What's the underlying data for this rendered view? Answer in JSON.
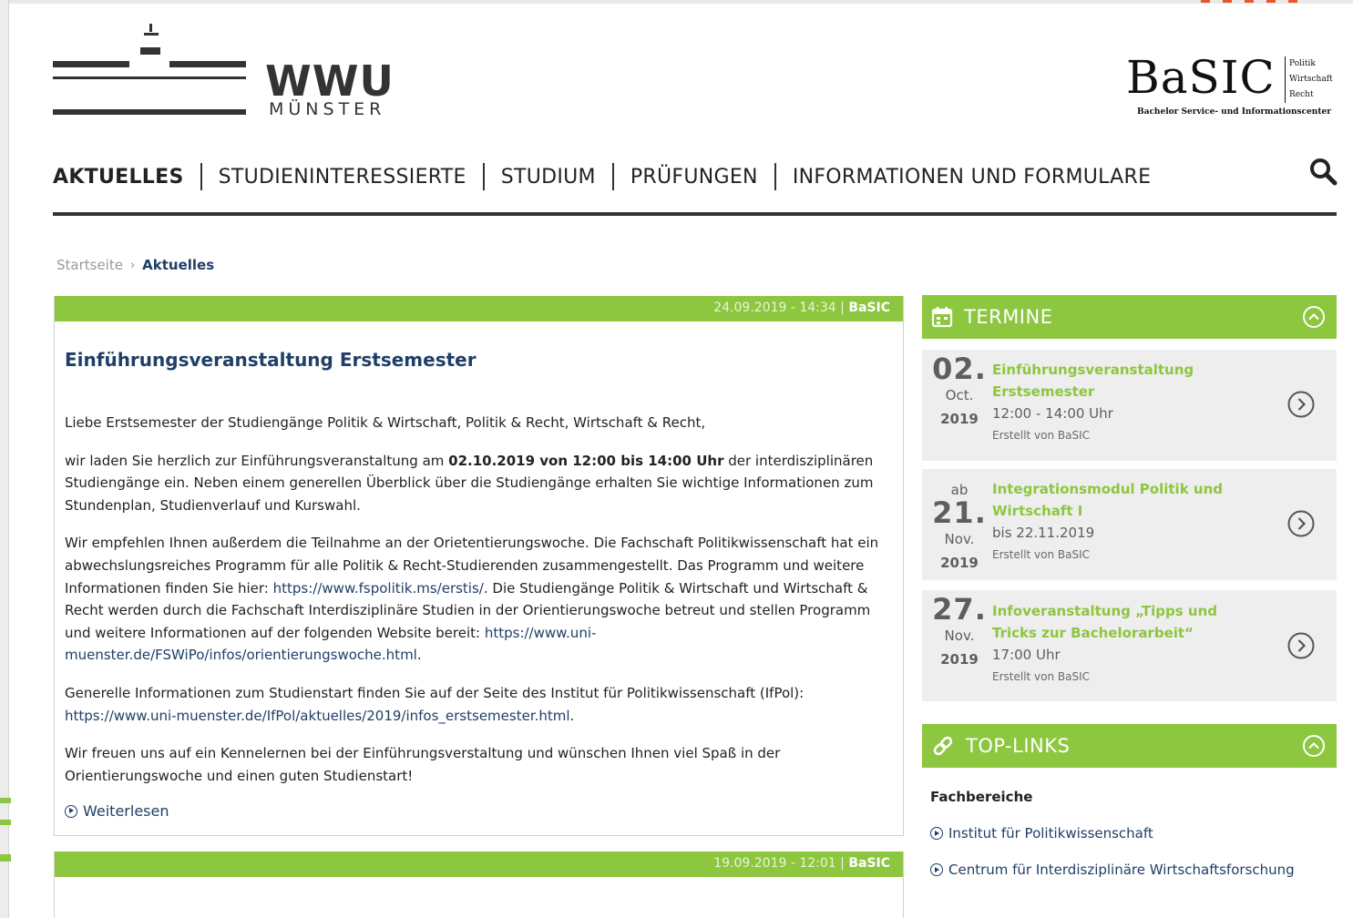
{
  "header": {
    "logo_wwu": {
      "name": "WWU",
      "subtitle": "MÜNSTER"
    },
    "logo_basic": {
      "name": "BaSIC",
      "side_lines": [
        "Politik",
        "Wirtschaft",
        "Recht"
      ],
      "tagline": "Bachelor Service- und Informationscenter"
    }
  },
  "nav": {
    "items": [
      {
        "label": "AKTUELLES",
        "active": true
      },
      {
        "label": "STUDIENINTERESSIERTE"
      },
      {
        "label": "STUDIUM"
      },
      {
        "label": "PRÜFUNGEN"
      },
      {
        "label": "INFORMATIONEN UND FORMULARE"
      }
    ],
    "search_icon": "search-icon"
  },
  "breadcrumb": {
    "home": "Startseite",
    "separator": "›",
    "current": "Aktuelles"
  },
  "article": {
    "meta_date": "24.09.2019 - 14:34 |",
    "meta_author": "BaSIC",
    "title": "Einführungsveranstaltung Erstsemester",
    "p1": "Liebe Erstsemester der Studiengänge Politik & Wirtschaft, Politik & Recht, Wirtschaft & Recht,",
    "p2_a": "wir laden Sie herzlich zur Einführungsveranstaltung am ",
    "p2_b": "02.10.2019 von 12:00 bis 14:00 Uhr",
    "p2_c": " der interdisziplinären Studiengänge ein. Neben einem generellen Überblick über die Studiengänge erhalten Sie wichtige Informationen zum Stundenplan, Studienverlauf und Kurswahl.",
    "p3_a": "Wir empfehlen Ihnen außerdem die Teilnahme an der Orietentierungswoche. Die Fachschaft Politikwissenschaft hat ein abwechslungsreiches Programm für alle Politik & Recht-Studierenden zusammengestellt. Das Programm und weitere Informationen finden Sie hier: ",
    "p3_link1": "https://www.fspolitik.ms/erstis/",
    "p3_b": ". Die Studiengänge Politik & Wirtschaft und Wirtschaft & Recht werden durch die Fachschaft Interdisziplinäre Studien in der Orientierungswoche betreut und stellen Programm und weitere Informationen auf der folgenden Website bereit: ",
    "p3_link2": "https://www.uni-muenster.de/FSWiPo/infos/orientierungswoche.html",
    "p3_c": ".",
    "p4_a": "Generelle Informationen zum Studienstart finden Sie auf der Seite des Institut für Politikwissenschaft (IfPol): ",
    "p4_link": "https://www.uni-muenster.de/IfPol/aktuelles/2019/infos_erstsemester.html",
    "p4_c": ".",
    "p5": "Wir freuen uns auf ein Kennelernen bei der Einführungsverstaltung und wünschen Ihnen viel Spaß in der Orientierungswoche und einen guten Studienstart!",
    "read_more": "Weiterlesen"
  },
  "article2": {
    "meta_date": "19.09.2019 - 12:01 |",
    "meta_author": "BaSIC"
  },
  "termine": {
    "title": "TERMINE",
    "icon": "calendar-icon",
    "events": [
      {
        "prefix": "",
        "day": "02.",
        "month": "Oct.",
        "year": "2019",
        "title": "Einführungsveranstaltung Erstsemester",
        "time": "12:00 - 14:00 Uhr",
        "author": "Erstellt von BaSIC"
      },
      {
        "prefix": "ab",
        "day": "21.",
        "month": "Nov.",
        "year": "2019",
        "title": "Integrationsmodul Politik und Wirtschaft I",
        "time": "bis 22.11.2019",
        "author": "Erstellt von BaSIC"
      },
      {
        "prefix": "",
        "day": "27.",
        "month": "Nov.",
        "year": "2019",
        "title": "Infoveranstaltung „Tipps und Tricks zur Bachelorarbeit“",
        "time": "17:00 Uhr",
        "author": "Erstellt von BaSIC"
      }
    ]
  },
  "toplinks": {
    "title": "TOP-LINKS",
    "icon": "link-icon",
    "heading": "Fachbereiche",
    "items": [
      "Institut für Politikwissenschaft",
      "Centrum für Interdisziplinäre Wirtschaftsforschung"
    ]
  },
  "colors": {
    "green": "#8dc63f",
    "navy": "#1f3f66",
    "panel_bg": "#eeeeee"
  }
}
